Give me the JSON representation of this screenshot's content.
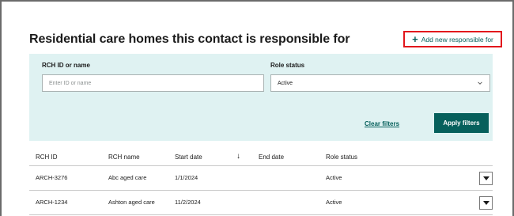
{
  "section": {
    "title": "Residential care homes this contact is responsible for",
    "add_button_label": "Add new responsible for"
  },
  "filters": {
    "id_label": "RCH ID or name",
    "id_placeholder": "Enter ID or name",
    "id_value": "",
    "role_label": "Role status",
    "role_value": "Active",
    "clear_label": "Clear filters",
    "apply_label": "Apply filters"
  },
  "table": {
    "columns": [
      "RCH ID",
      "RCH name",
      "Start date",
      "End date",
      "Role status"
    ],
    "rows": [
      {
        "id": "ARCH-3276",
        "name": "Abc aged care",
        "start": "1/1/2024",
        "end": "",
        "status": "Active"
      },
      {
        "id": "ARCH-1234",
        "name": "Ashton aged care",
        "start": "11/2/2024",
        "end": "",
        "status": "Active"
      }
    ]
  },
  "colors": {
    "accent": "#06605c",
    "filter_bg": "#dff2f2",
    "highlight_border": "#e2161c"
  }
}
